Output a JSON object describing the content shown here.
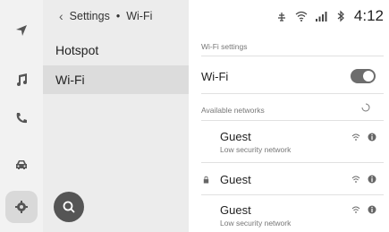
{
  "rail": {
    "icons": [
      "navigation-icon",
      "music-icon",
      "phone-icon",
      "car-icon",
      "settings-icon"
    ]
  },
  "menu": {
    "breadcrumb": {
      "root": "Settings",
      "separator": "•",
      "current": "Wi-Fi"
    },
    "items": [
      {
        "label": "Hotspot",
        "selected": false
      },
      {
        "label": "Wi-Fi",
        "selected": true
      }
    ]
  },
  "status_bar": {
    "time": "4:12",
    "icons": [
      "antenna-icon",
      "wifi-icon",
      "signal-bars-icon",
      "bluetooth-icon"
    ]
  },
  "wifi_settings": {
    "section_label": "Wi-Fi settings",
    "toggle_label": "Wi-Fi",
    "toggle_on": true
  },
  "networks": {
    "section_label": "Available networks",
    "list": [
      {
        "name": "Guest",
        "subtitle": "Low security network",
        "locked": false
      },
      {
        "name": "Guest",
        "subtitle": "",
        "locked": true
      },
      {
        "name": "Guest",
        "subtitle": "Low security network",
        "locked": false
      }
    ]
  },
  "colors": {
    "rail_bg": "#f2f2f2",
    "menu_bg": "#ececec",
    "selected_bg": "#dcdcdc",
    "accent_dark": "#555555",
    "toggle_on": "#6d6d6d"
  }
}
